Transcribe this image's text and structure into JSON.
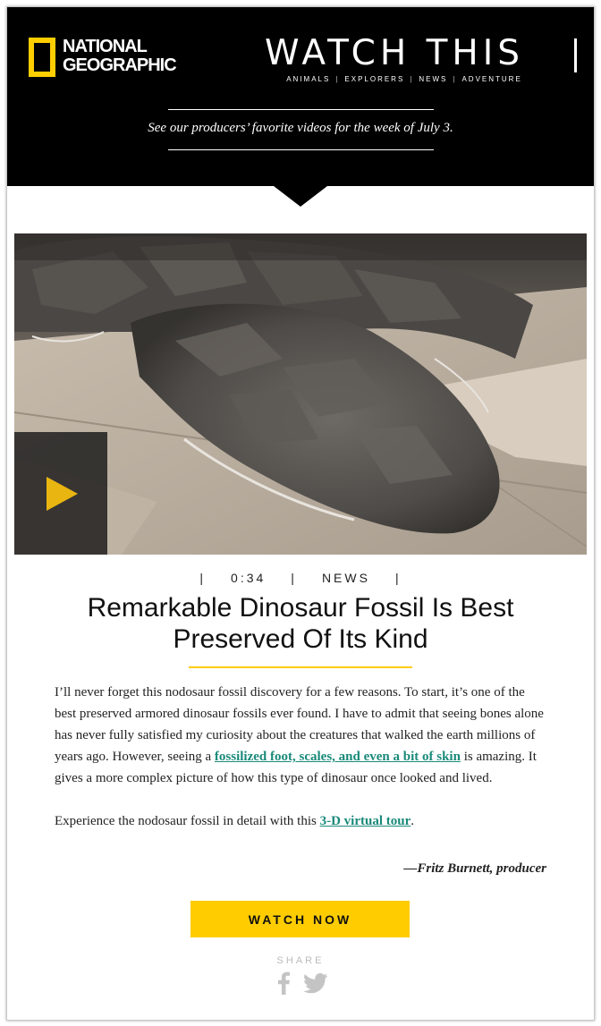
{
  "header": {
    "logo_line1": "NATIONAL",
    "logo_line2": "GEOGRAPHIC",
    "title": "WATCH THIS",
    "sections": [
      "ANIMALS",
      "EXPLORERS",
      "NEWS",
      "ADVENTURE"
    ],
    "tagline": "See our producers’ favorite videos for the week of July 3."
  },
  "video": {
    "duration": "0:34",
    "category": "NEWS",
    "play_icon": "play-icon"
  },
  "article": {
    "headline": "Remarkable Dinosaur Fossil Is Best Preserved Of Its Kind",
    "para1_before": "I’ll never forget this nodosaur fossil discovery for a few reasons. To start, it’s one of the best preserved armored dinosaur fossils ever found. I have to admit that seeing bones alone has never fully satisfied my curiosity about the creatures that walked the earth millions of years ago. However, seeing a ",
    "para1_link": "fossilized foot, scales, and even a bit of skin",
    "para1_after": " is amazing. It gives a more complex picture of how this type of dinosaur once looked and lived.",
    "para2_before": "Experience the nodosaur fossil in detail with this ",
    "para2_link": "3-D virtual tour",
    "para2_after": ".",
    "byline": "—Fritz Burnett, producer"
  },
  "cta": {
    "label": "WATCH NOW"
  },
  "share": {
    "label": "SHARE",
    "icons": [
      "facebook-icon",
      "twitter-icon"
    ]
  },
  "colors": {
    "brand_yellow": "#ffcc00",
    "link_teal": "#1a8a7a",
    "header_bg": "#000000",
    "play_yellow": "#e9b511"
  }
}
